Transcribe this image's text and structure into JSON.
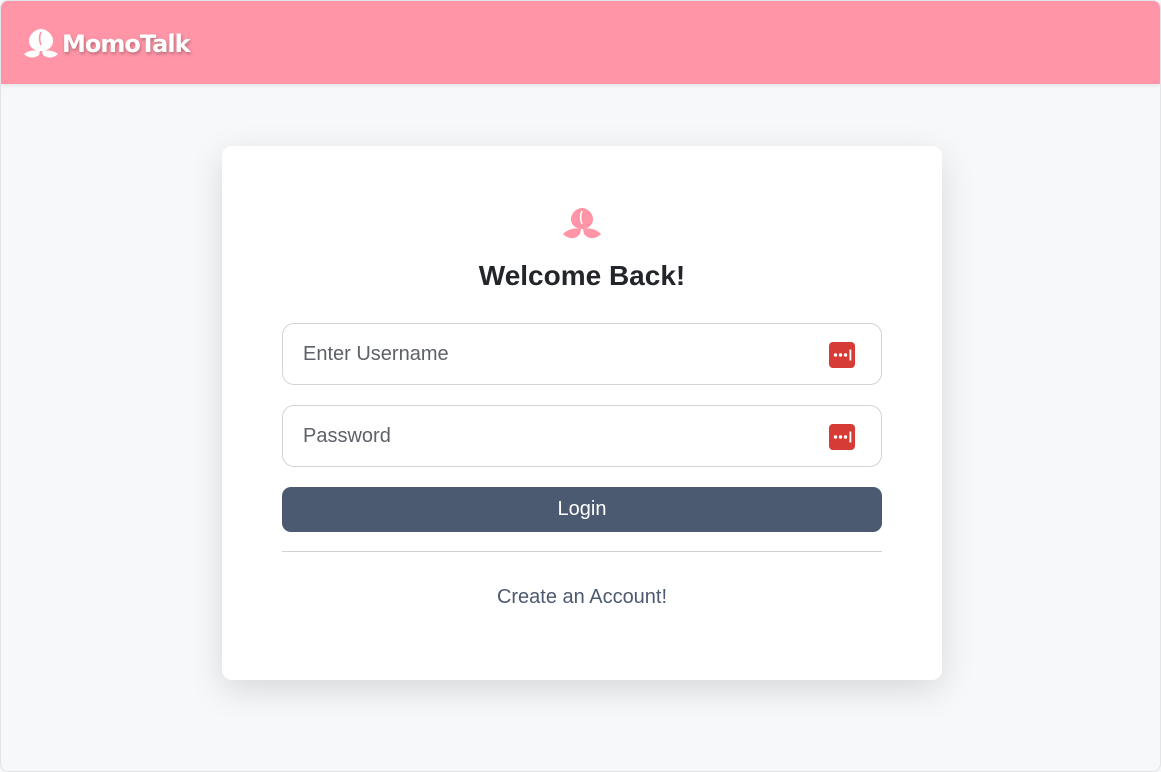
{
  "header": {
    "brand_text": "MomoTalk",
    "brand_icon": "peach-icon",
    "background_color": "#ff95a6"
  },
  "card": {
    "logo_icon": "peach-icon",
    "title": "Welcome Back!"
  },
  "form": {
    "username": {
      "placeholder": "Enter Username",
      "value": "",
      "autofill_icon": "password-manager-icon"
    },
    "password": {
      "placeholder": "Password",
      "value": "",
      "autofill_icon": "password-manager-icon"
    },
    "login_label": "Login",
    "create_account_label": "Create an Account!"
  },
  "colors": {
    "accent": "#ff95a6",
    "button": "#4b5a71",
    "autofill_icon": "#d63b35",
    "page_background": "#f7f8fa"
  }
}
